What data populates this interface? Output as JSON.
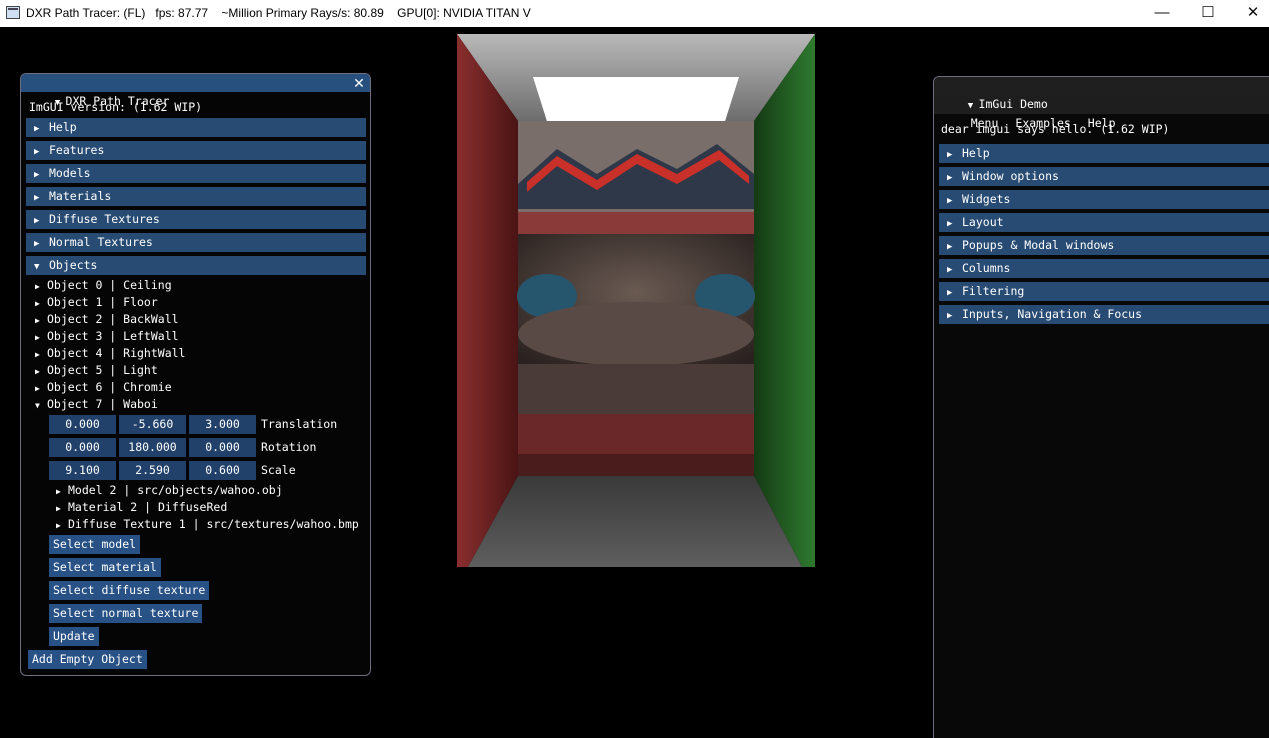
{
  "titlebar": {
    "title": "DXR Path Tracer: (FL)   fps: 87.77    ~Million Primary Rays/s: 80.89    GPU[0]: NVIDIA TITAN V",
    "minimize": "—",
    "maximize": "☐",
    "close": "✕"
  },
  "left_panel": {
    "title": "DXR Path Tracer",
    "close": "✕",
    "version": "ImGUI version: (1.62 WIP)",
    "headers": [
      "Help",
      "Features",
      "Models",
      "Materials",
      "Diffuse Textures",
      "Normal Textures",
      "Objects"
    ],
    "objects": [
      "Object 0 | Ceiling",
      "Object 1 | Floor",
      "Object 2 | BackWall",
      "Object 3 | LeftWall",
      "Object 4 | RightWall",
      "Object 5 | Light",
      "Object 6 | Chromie",
      "Object 7 | Waboi"
    ],
    "transform": {
      "translation": {
        "x": "0.000",
        "y": "-5.660",
        "z": "3.000",
        "label": "Translation"
      },
      "rotation": {
        "x": "0.000",
        "y": "180.000",
        "z": "0.000",
        "label": "Rotation"
      },
      "scale": {
        "x": "9.100",
        "y": "2.590",
        "z": "0.600",
        "label": "Scale"
      }
    },
    "subnodes": [
      "Model 2 | src/objects/wahoo.obj",
      "Material 2 | DiffuseRed",
      "Diffuse Texture 1 | src/textures/wahoo.bmp"
    ],
    "buttons": {
      "select_model": "Select model",
      "select_material": "Select material",
      "select_diffuse": "Select diffuse texture",
      "select_normal": "Select normal texture",
      "update": "Update",
      "add_empty": "Add Empty Object"
    }
  },
  "right_panel": {
    "title": "ImGui Demo",
    "menu": [
      "Menu",
      "Examples",
      "Help"
    ],
    "hello": "dear imgui says hello. (1.62 WIP)",
    "headers": [
      "Help",
      "Window options",
      "Widgets",
      "Layout",
      "Popups & Modal windows",
      "Columns",
      "Filtering",
      "Inputs, Navigation & Focus"
    ]
  },
  "colors": {
    "header": "#284b73",
    "title_active": "#27507f",
    "button": "#285186",
    "frame": "#22416a"
  }
}
